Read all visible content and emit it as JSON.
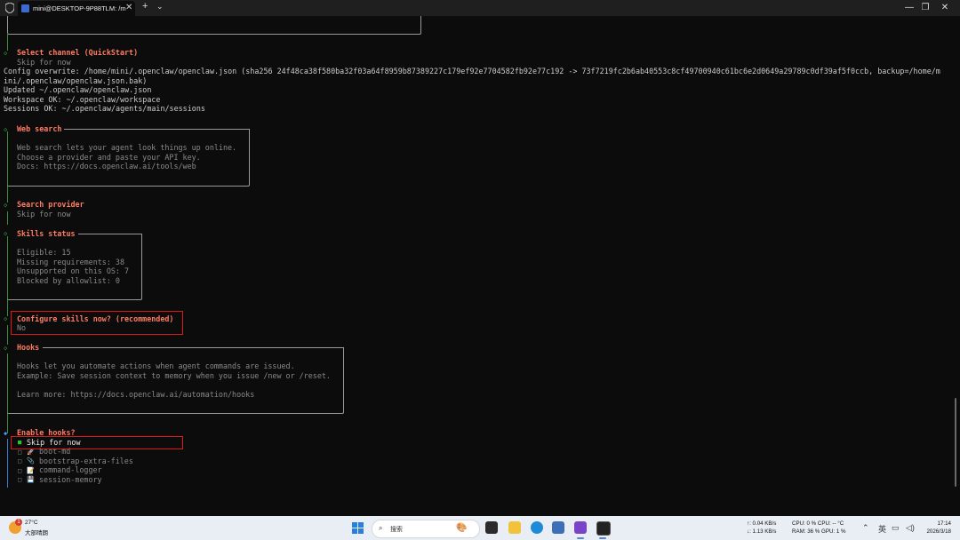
{
  "titlebar": {
    "tab_title": "mini@DESKTOP-9P88TLM: /m",
    "tab_close": "✕",
    "new_tab": "+",
    "dropdown": "⌄",
    "minimize": "—",
    "maximize": "❐",
    "close": "✕"
  },
  "terminal": {
    "select_channel_title": "Select channel (QuickStart)",
    "select_channel_value": "Skip for now",
    "config_overwrite_1": "Config overwrite: /home/mini/.openclaw/openclaw.json (sha256 24f48ca38f580ba32f03a64f8959b87389227c179ef92e7704582fb92e77c192 -> 73f7219fc2b6ab40553c8cf49700940c61bc6e2d0649a29789c0df39af5f0ccb, backup=/home/m",
    "config_overwrite_2": "ini/.openclaw/openclaw.json.bak)",
    "updated": "Updated ~/.openclaw/openclaw.json",
    "workspace_ok": "Workspace OK: ~/.openclaw/workspace",
    "sessions_ok": "Sessions OK: ~/.openclaw/agents/main/sessions",
    "web_search_title": "Web search",
    "web_search_lines": [
      "Web search lets your agent look things up online.",
      "Choose a provider and paste your API key.",
      "Docs: https://docs.openclaw.ai/tools/web"
    ],
    "search_provider_title": "Search provider",
    "search_provider_value": "Skip for now",
    "skills_status_title": "Skills status",
    "skills_status_lines": [
      "Eligible: 15",
      "Missing requirements: 38",
      "Unsupported on this OS: 7",
      "Blocked by allowlist: 0"
    ],
    "configure_skills_title": "Configure skills now? (recommended)",
    "configure_skills_value": "No",
    "hooks_title": "Hooks",
    "hooks_lines": [
      "Hooks let you automate actions when agent commands are issued.",
      "Example: Save session context to memory when you issue /new or /reset.",
      "",
      "Learn more: https://docs.openclaw.ai/automation/hooks"
    ],
    "enable_hooks_title": "Enable hooks?",
    "hook_options": [
      {
        "label": "Skip for now",
        "emoji": "",
        "checked": true
      },
      {
        "label": "boot-md",
        "emoji": "🚀",
        "checked": false
      },
      {
        "label": "bootstrap-extra-files",
        "emoji": "📎",
        "checked": false
      },
      {
        "label": "command-logger",
        "emoji": "📝",
        "checked": false
      },
      {
        "label": "session-memory",
        "emoji": "💾",
        "checked": false
      }
    ],
    "box_dash": "─",
    "diamond": "◇",
    "diamond_active": "◆"
  },
  "taskbar": {
    "weather_temp": "27°C",
    "weather_desc": "大部晴朗",
    "weather_badge": "1",
    "search_placeholder": "搜索",
    "net_up": "↑: 0.04 KB/s",
    "net_down": "↓: 1.13 KB/s",
    "cpu_line1": "CPU: 0 %    CPU: -- °C",
    "cpu_line2": "RAM: 36 % GPU: 1 %",
    "ime": "英",
    "time": "17:14",
    "date": "2026/3/18"
  },
  "colors": {
    "heading": "#ff7b63",
    "bar": "#3d8b3d",
    "highlight": "#e01818",
    "checked": "#2ec22e"
  }
}
